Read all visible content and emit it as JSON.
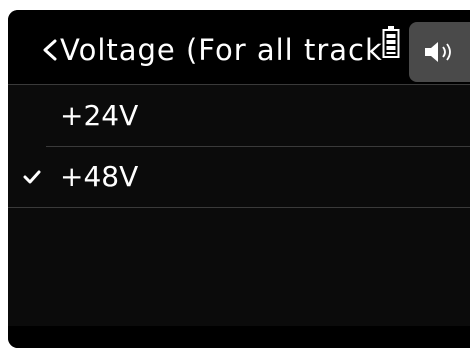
{
  "header": {
    "title": "Voltage (For all track",
    "back_icon": "chevron-left-icon",
    "battery_icon": "battery-icon",
    "speaker_icon": "speaker-icon"
  },
  "voltage_options": {
    "items": [
      {
        "label": "+24V",
        "selected": false
      },
      {
        "label": "+48V",
        "selected": true
      }
    ]
  },
  "colors": {
    "background": "#000000",
    "text": "#ffffff",
    "divider": "#3a3a3a",
    "speaker_button": "#4a4a4a"
  }
}
